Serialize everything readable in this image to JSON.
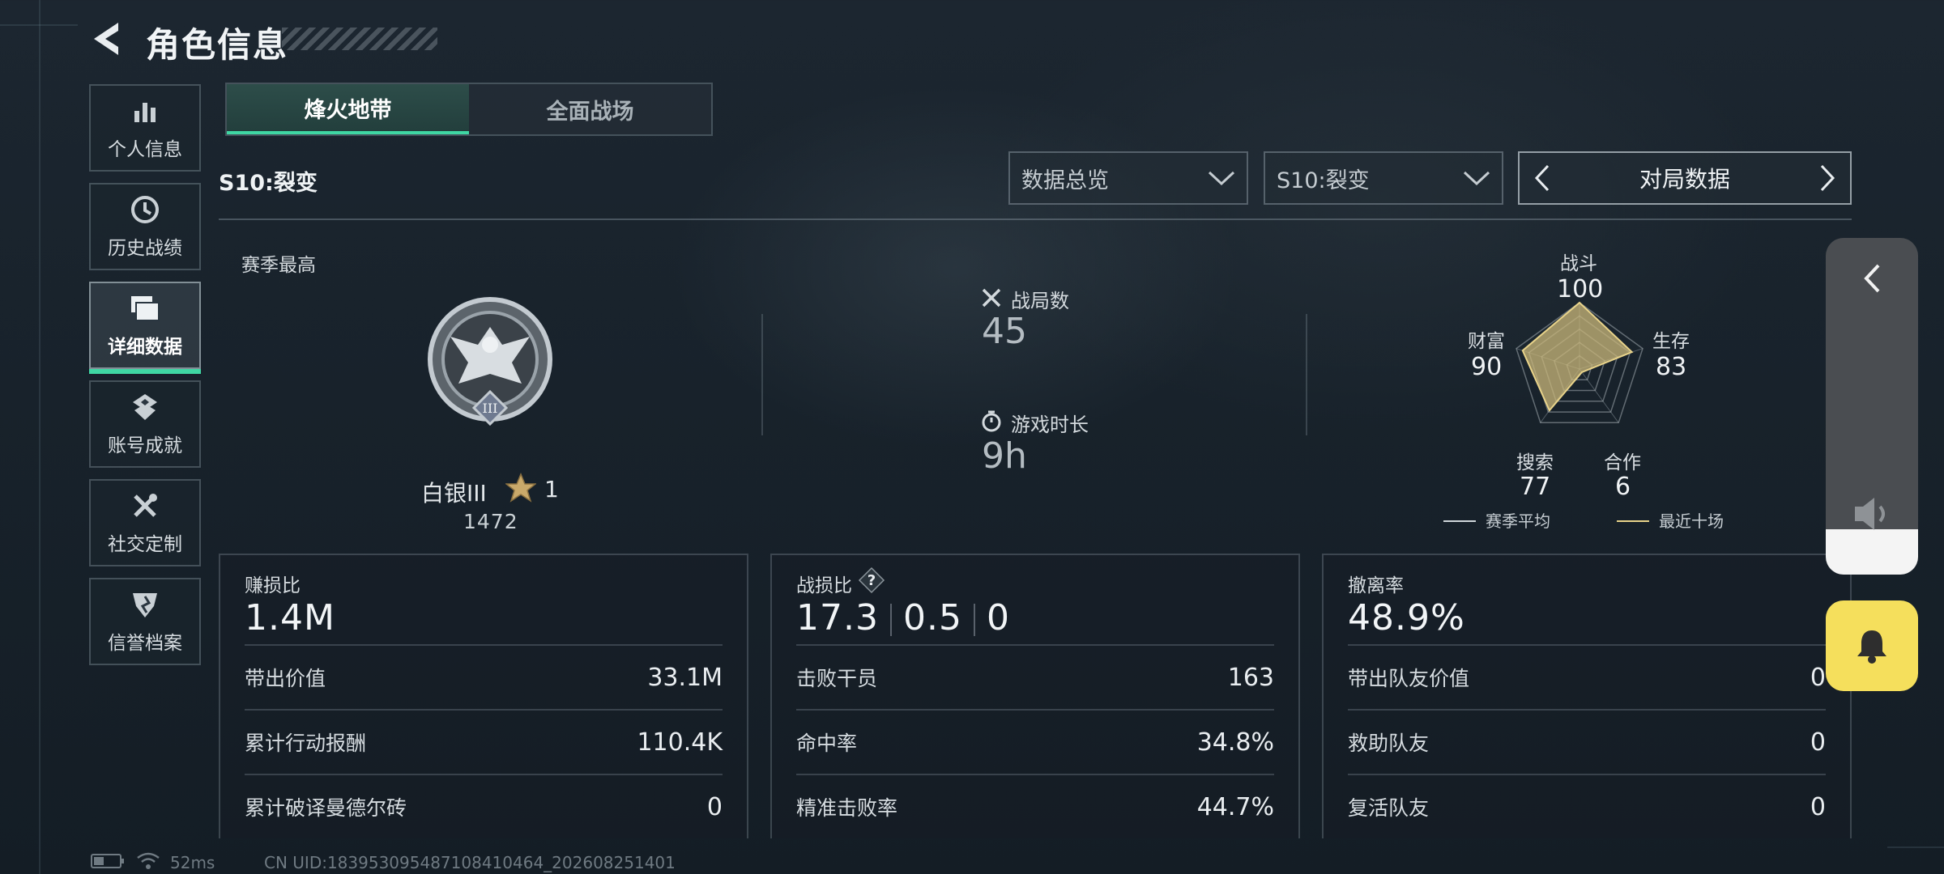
{
  "header": {
    "title": "角色信息"
  },
  "sidebar": {
    "items": [
      {
        "label": "个人信息",
        "icon": "bar-chart-icon",
        "active": false
      },
      {
        "label": "历史战绩",
        "icon": "clock-icon",
        "active": false
      },
      {
        "label": "详细数据",
        "icon": "folder-icon",
        "active": true
      },
      {
        "label": "账号成就",
        "icon": "badge-icon",
        "active": false
      },
      {
        "label": "社交定制",
        "icon": "tools-icon",
        "active": false
      },
      {
        "label": "信誉档案",
        "icon": "shield-icon",
        "active": false
      }
    ]
  },
  "tabs": [
    {
      "label": "烽火地带",
      "active": true
    },
    {
      "label": "全面战场",
      "active": false
    }
  ],
  "season": {
    "title": "S10:裂变"
  },
  "filters": {
    "data_type": "数据总览",
    "season": "S10:裂变",
    "stat_view": "对局数据"
  },
  "summary": {
    "season_best_label": "赛季最高",
    "rank_name": "白银III",
    "rank_stars": "1",
    "rank_score": "1472",
    "matches_label": "战局数",
    "matches_value": "45",
    "playtime_label": "游戏时长",
    "playtime_value": "9h"
  },
  "radar": {
    "axes": [
      {
        "label": "战斗",
        "value": "100"
      },
      {
        "label": "生存",
        "value": "83"
      },
      {
        "label": "合作",
        "value": "6"
      },
      {
        "label": "搜索",
        "value": "77"
      },
      {
        "label": "财富",
        "value": "90"
      }
    ],
    "legend": {
      "season_avg": "赛季平均",
      "recent_ten": "最近十场"
    },
    "colors": {
      "fill": "#c9b77a",
      "stroke": "#e8d38a"
    }
  },
  "panels": {
    "profit": {
      "label": "赚损比",
      "big": "1.4M",
      "rows": [
        {
          "label": "带出价值",
          "value": "33.1M"
        },
        {
          "label": "累计行动报酬",
          "value": "110.4K"
        },
        {
          "label": "累计破译曼德尔砖",
          "value": "0"
        }
      ]
    },
    "combat": {
      "label": "战损比",
      "values": [
        "17.3",
        "0.5",
        "0"
      ],
      "rows": [
        {
          "label": "击败干员",
          "value": "163"
        },
        {
          "label": "命中率",
          "value": "34.8%"
        },
        {
          "label": "精准击败率",
          "value": "44.7%"
        }
      ]
    },
    "extract": {
      "label": "撤离率",
      "big": "48.9%",
      "rows": [
        {
          "label": "带出队友价值",
          "value": "0"
        },
        {
          "label": "救助队友",
          "value": "0"
        },
        {
          "label": "复活队友",
          "value": "0"
        }
      ]
    }
  },
  "status": {
    "ping": "52ms",
    "uid": "CN UID:183953095487108410464_202608251401"
  },
  "colors": {
    "accent": "#3fd7a3",
    "bell": "#f5df5c"
  }
}
